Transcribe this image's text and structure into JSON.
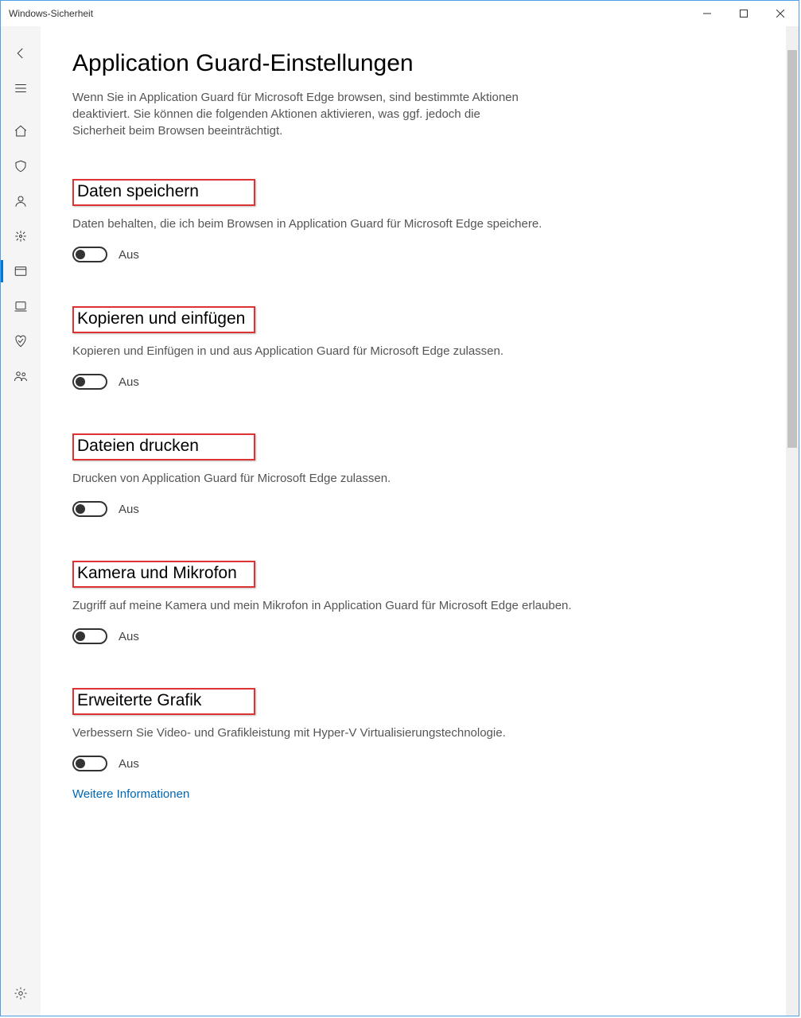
{
  "window": {
    "title": "Windows-Sicherheit"
  },
  "sidebar": {
    "back": "back",
    "items": [
      {
        "name": "menu-icon"
      },
      {
        "name": "home-icon"
      },
      {
        "name": "shield-icon"
      },
      {
        "name": "account-icon"
      },
      {
        "name": "firewall-icon"
      },
      {
        "name": "app-browser-icon",
        "active": true
      },
      {
        "name": "device-security-icon"
      },
      {
        "name": "device-performance-icon"
      },
      {
        "name": "family-icon"
      }
    ],
    "settings": "settings-icon"
  },
  "main": {
    "heading": "Application Guard-Einstellungen",
    "intro": "Wenn Sie in Application Guard für Microsoft Edge browsen, sind bestimmte Aktionen deaktiviert. Sie können die folgenden Aktionen aktivieren, was ggf. jedoch die Sicherheit beim Browsen beeinträchtigt.",
    "toggle_off_label": "Aus",
    "sections": [
      {
        "title": "Daten speichern",
        "desc": "Daten behalten, die ich beim Browsen in Application Guard für Microsoft Edge speichere.",
        "state": "off"
      },
      {
        "title": "Kopieren und einfügen",
        "desc": "Kopieren und Einfügen in und aus Application Guard für Microsoft Edge zulassen.",
        "state": "off"
      },
      {
        "title": "Dateien drucken",
        "desc": "Drucken von Application Guard für Microsoft Edge zulassen.",
        "state": "off"
      },
      {
        "title": "Kamera und Mikrofon",
        "desc": "Zugriff auf meine Kamera und mein Mikrofon in Application Guard für Microsoft Edge erlauben.",
        "state": "off"
      },
      {
        "title": "Erweiterte Grafik",
        "desc": "Verbessern Sie Video- und Grafikleistung mit Hyper-V Virtualisierungstechnologie.",
        "state": "off"
      }
    ],
    "more_info_link": "Weitere Informationen"
  }
}
